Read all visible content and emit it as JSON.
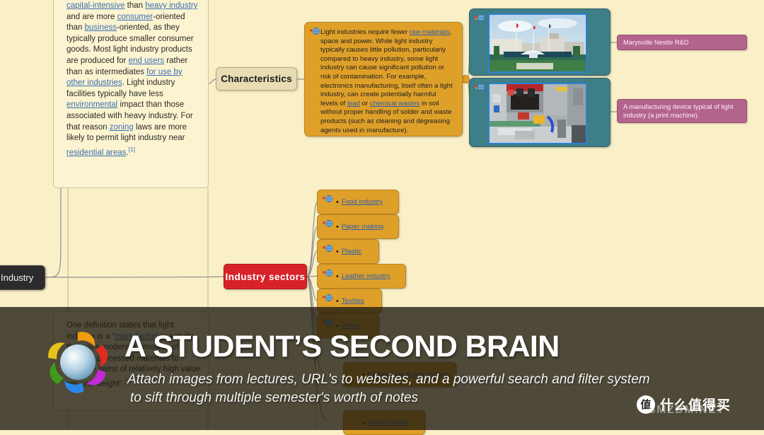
{
  "app": {
    "background_color": "#faf0c8",
    "overlay_color": "rgba(30,26,16,0.78)"
  },
  "mindmap": {
    "root_node": {
      "label": "Industry",
      "color": "#2b2b2b"
    },
    "branch_characteristics": {
      "label": "Characteristics",
      "color": "#e8dcb5"
    },
    "branch_sectors": {
      "label": "Industry sectors",
      "color": "#d8222a"
    },
    "wiki_note": {
      "html": "<a>capital-intensive</a> than <a>heavy industry</a> and are more <a>consumer</a>-oriented than <a>business</a>-oriented, as they typically produce smaller consumer goods. Most light industry products are produced for <a>end users</a> rather than as intermediates <a>for use by other industries</a>. Light industry facilities typically have less <a>environmental</a> impact than those associated with heavy industry. For that reason <a>zoning</a> laws are more likely to permit light industry near <a>residential areas</a>.<sup>[1]</sup>"
    },
    "orange_note": {
      "html": "Light industries require fewer <a>raw materials</a>, space and power. While light industry typically causes little pollution, particularly compared to heavy industry, some light industry can cause significant pollution or risk of contamination. For example, electronics manufacturing, itself often a light industry, can create potentially harmful levels of <a>lead</a> or <a>chemical wastes</a> in soil without proper handling of solder and waste products (such as cleaning and degreasing agents used in manufacture)."
    },
    "dimmed_note": {
      "html": "One definition states that light industry is a \"<a>manufacturing</a> activity that uses moderate amounts of partially processed materials to produce items of relatively high value per unit weight\".<sup>[2]</sup>"
    },
    "image_nodes": [
      {
        "caption": "Marysville Nestle R&D",
        "alt": "marysville-nestle-building-photo"
      },
      {
        "caption": "A manufacturing device typical of light industry (a print machine).",
        "alt": "print-machine-photo"
      }
    ],
    "sectors": [
      {
        "label": "Food industry",
        "dimmed": false
      },
      {
        "label": "Paper making",
        "dimmed": false
      },
      {
        "label": "Plastic",
        "dimmed": false
      },
      {
        "label": "Leather industry",
        "dimmed": false
      },
      {
        "label": "Textiles",
        "dimmed": false
      },
      {
        "label": "Wood",
        "dimmed": true
      },
      {
        "label": "Kitchen and dining products",
        "dimmed": true
      },
      {
        "label": "Home textiles",
        "dimmed": true
      }
    ],
    "node_colors": {
      "leaf": "#dfa02a",
      "image_frame": "#3e7f87",
      "caption": "#b3648c",
      "link_text": "#2a5fae"
    }
  },
  "overlay": {
    "title": "A STUDENT’S SECOND BRAIN",
    "subtitle_line1": "Attach images from lectures, URL's to websites, and a powerful search and filter system",
    "subtitle_line2": "to sift through multiple semester's worth of notes",
    "logo_name": "pinwheel-logo"
  },
  "watermark": {
    "badge": "值",
    "text": "什么值得买",
    "sub": "SMZDM.NET"
  }
}
